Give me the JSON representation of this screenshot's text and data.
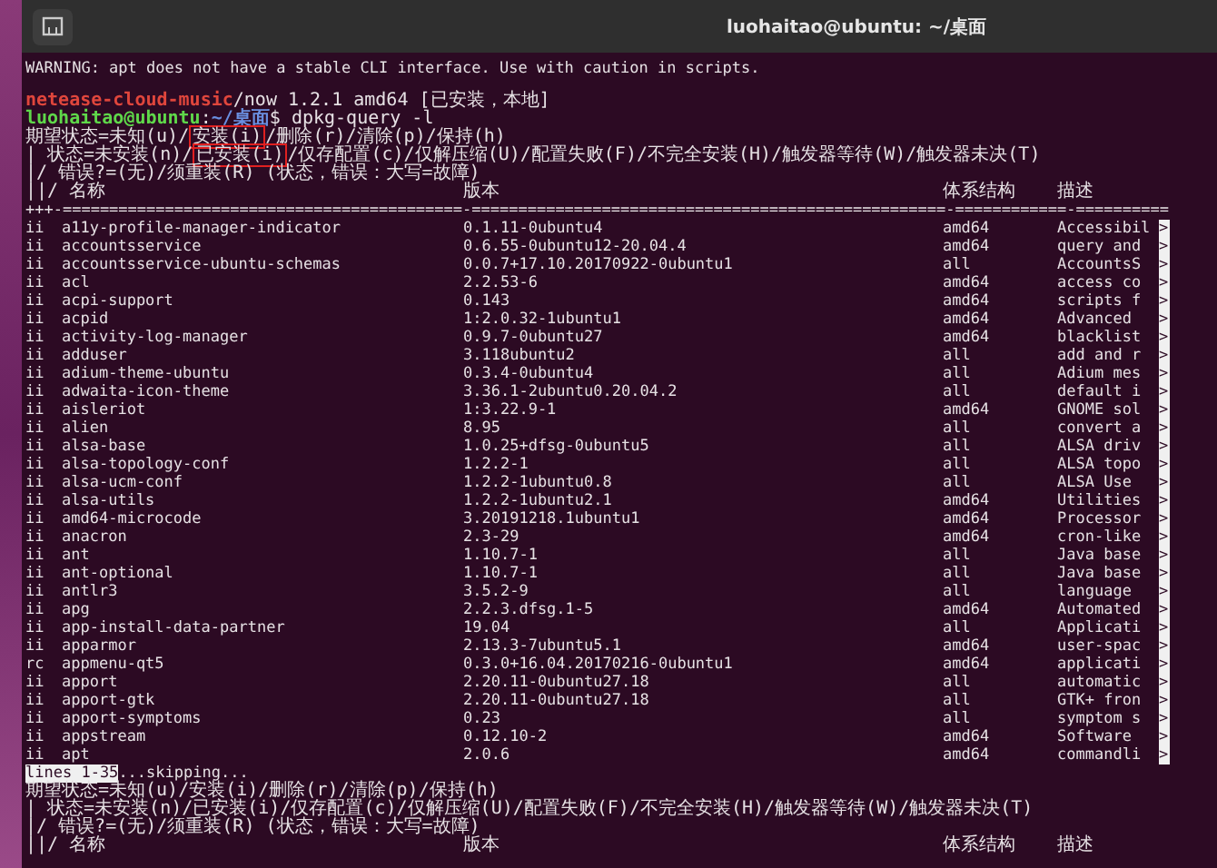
{
  "window": {
    "title": "luohaitao@ubuntu: ~/桌面"
  },
  "top_lines": [
    {
      "kind": "output",
      "parts": [
        {
          "kind": "plain",
          "text": "WARNING: apt does not have a stable CLI interface. Use with caution in scripts."
        }
      ]
    },
    {
      "kind": "legend",
      "parts": [
        {
          "kind": "package",
          "text": "netease-cloud-music"
        },
        {
          "kind": "plain",
          "text": "/now 1.2.1 amd64 [已安装，本地]"
        }
      ]
    },
    {
      "kind": "legend",
      "parts": [
        {
          "kind": "user",
          "text": "luohaitao@ubuntu"
        },
        {
          "kind": "plain",
          "text": ":"
        },
        {
          "kind": "path",
          "text": "~/桌面"
        },
        {
          "kind": "plain",
          "text": "$ dpkg-query -l"
        }
      ]
    },
    {
      "kind": "legend",
      "parts": [
        {
          "kind": "plain",
          "text": "期望状态=未知(u)/"
        },
        {
          "kind": "boxed",
          "text": "安装(i)"
        },
        {
          "kind": "plain",
          "text": "/删除(r)/清除(p)/保持(h)"
        }
      ]
    },
    {
      "kind": "legend",
      "parts": [
        {
          "kind": "plain",
          "text": "| 状态=未安装(n)/"
        },
        {
          "kind": "boxed",
          "text": "已安装(i)"
        },
        {
          "kind": "plain",
          "text": "/仅存配置(c)/仅解压缩(U)/配置失败(F)/不完全安装(H)/触发器等待(W)/触发器未决(T)"
        }
      ]
    },
    {
      "kind": "legend",
      "parts": [
        {
          "kind": "plain",
          "text": "|/ 错误?=(无)/须重装(R) (状态，错误：大写=故障)"
        }
      ]
    }
  ],
  "table": {
    "header": {
      "name": "||/ 名称",
      "version": "版本",
      "arch": "体系结构",
      "desc": "描述"
    },
    "separator": "+++-===========================================-===================================================-============-==========",
    "rows": [
      {
        "status": "ii",
        "name": "a11y-profile-manager-indicator",
        "version": "0.1.11-0ubuntu4",
        "arch": "amd64",
        "desc": "Accessibil",
        "more": ">"
      },
      {
        "status": "ii",
        "name": "accountsservice",
        "version": "0.6.55-0ubuntu12-20.04.4",
        "arch": "amd64",
        "desc": "query and",
        "more": ">"
      },
      {
        "status": "ii",
        "name": "accountsservice-ubuntu-schemas",
        "version": "0.0.7+17.10.20170922-0ubuntu1",
        "arch": "all",
        "desc": "AccountsS",
        "more": ">"
      },
      {
        "status": "ii",
        "name": "acl",
        "version": "2.2.53-6",
        "arch": "amd64",
        "desc": "access co",
        "more": ">"
      },
      {
        "status": "ii",
        "name": "acpi-support",
        "version": "0.143",
        "arch": "amd64",
        "desc": "scripts f",
        "more": ">"
      },
      {
        "status": "ii",
        "name": "acpid",
        "version": "1:2.0.32-1ubuntu1",
        "arch": "amd64",
        "desc": "Advanced",
        "more": ">"
      },
      {
        "status": "ii",
        "name": "activity-log-manager",
        "version": "0.9.7-0ubuntu27",
        "arch": "amd64",
        "desc": "blacklist",
        "more": ">"
      },
      {
        "status": "ii",
        "name": "adduser",
        "version": "3.118ubuntu2",
        "arch": "all",
        "desc": "add and r",
        "more": ">"
      },
      {
        "status": "ii",
        "name": "adium-theme-ubuntu",
        "version": "0.3.4-0ubuntu4",
        "arch": "all",
        "desc": "Adium mes",
        "more": ">"
      },
      {
        "status": "ii",
        "name": "adwaita-icon-theme",
        "version": "3.36.1-2ubuntu0.20.04.2",
        "arch": "all",
        "desc": "default i",
        "more": ">"
      },
      {
        "status": "ii",
        "name": "aisleriot",
        "version": "1:3.22.9-1",
        "arch": "amd64",
        "desc": "GNOME sol",
        "more": ">"
      },
      {
        "status": "ii",
        "name": "alien",
        "version": "8.95",
        "arch": "all",
        "desc": "convert a",
        "more": ">"
      },
      {
        "status": "ii",
        "name": "alsa-base",
        "version": "1.0.25+dfsg-0ubuntu5",
        "arch": "all",
        "desc": "ALSA driv",
        "more": ">"
      },
      {
        "status": "ii",
        "name": "alsa-topology-conf",
        "version": "1.2.2-1",
        "arch": "all",
        "desc": "ALSA topo",
        "more": ">"
      },
      {
        "status": "ii",
        "name": "alsa-ucm-conf",
        "version": "1.2.2-1ubuntu0.8",
        "arch": "all",
        "desc": "ALSA Use",
        "more": ">"
      },
      {
        "status": "ii",
        "name": "alsa-utils",
        "version": "1.2.2-1ubuntu2.1",
        "arch": "amd64",
        "desc": "Utilities",
        "more": ">"
      },
      {
        "status": "ii",
        "name": "amd64-microcode",
        "version": "3.20191218.1ubuntu1",
        "arch": "amd64",
        "desc": "Processor",
        "more": ">"
      },
      {
        "status": "ii",
        "name": "anacron",
        "version": "2.3-29",
        "arch": "amd64",
        "desc": "cron-like",
        "more": ">"
      },
      {
        "status": "ii",
        "name": "ant",
        "version": "1.10.7-1",
        "arch": "all",
        "desc": "Java base",
        "more": ">"
      },
      {
        "status": "ii",
        "name": "ant-optional",
        "version": "1.10.7-1",
        "arch": "all",
        "desc": "Java base",
        "more": ">"
      },
      {
        "status": "ii",
        "name": "antlr3",
        "version": "3.5.2-9",
        "arch": "all",
        "desc": "language",
        "more": ">"
      },
      {
        "status": "ii",
        "name": "apg",
        "version": "2.2.3.dfsg.1-5",
        "arch": "amd64",
        "desc": "Automated",
        "more": ">"
      },
      {
        "status": "ii",
        "name": "app-install-data-partner",
        "version": "19.04",
        "arch": "all",
        "desc": "Applicati",
        "more": ">"
      },
      {
        "status": "ii",
        "name": "apparmor",
        "version": "2.13.3-7ubuntu5.1",
        "arch": "amd64",
        "desc": "user-spac",
        "more": ">"
      },
      {
        "status": "rc",
        "name": "appmenu-qt5",
        "version": "0.3.0+16.04.20170216-0ubuntu1",
        "arch": "amd64",
        "desc": "applicati",
        "more": ">"
      },
      {
        "status": "ii",
        "name": "apport",
        "version": "2.20.11-0ubuntu27.18",
        "arch": "all",
        "desc": "automatic",
        "more": ">"
      },
      {
        "status": "ii",
        "name": "apport-gtk",
        "version": "2.20.11-0ubuntu27.18",
        "arch": "all",
        "desc": "GTK+ fron",
        "more": ">"
      },
      {
        "status": "ii",
        "name": "apport-symptoms",
        "version": "0.23",
        "arch": "all",
        "desc": "symptom s",
        "more": ">"
      },
      {
        "status": "ii",
        "name": "appstream",
        "version": "0.12.10-2",
        "arch": "amd64",
        "desc": "Software",
        "more": ">"
      },
      {
        "status": "ii",
        "name": "apt",
        "version": "2.0.6",
        "arch": "amd64",
        "desc": "commandli",
        "more": ">"
      }
    ]
  },
  "bottom_lines": [
    {
      "kind": "output",
      "parts": [
        {
          "kind": "inverse",
          "text": "lines 1-35"
        },
        {
          "kind": "plain",
          "text": "...skipping..."
        }
      ]
    },
    {
      "kind": "legend",
      "parts": [
        {
          "kind": "plain",
          "text": "期望状态=未知(u)/安装(i)/删除(r)/清除(p)/保持(h)"
        }
      ]
    },
    {
      "kind": "legend",
      "parts": [
        {
          "kind": "plain",
          "text": "| 状态=未安装(n)/已安装(i)/仅存配置(c)/仅解压缩(U)/配置失败(F)/不完全安装(H)/触发器等待(W)/触发器未决(T)"
        }
      ]
    },
    {
      "kind": "legend",
      "parts": [
        {
          "kind": "plain",
          "text": "|/ 错误?=(无)/须重装(R) (状态，错误：大写=故障)"
        }
      ]
    }
  ],
  "bottom_header": {
    "name": "||/ 名称",
    "version": "版本",
    "arch": "体系结构",
    "desc": "描述"
  }
}
